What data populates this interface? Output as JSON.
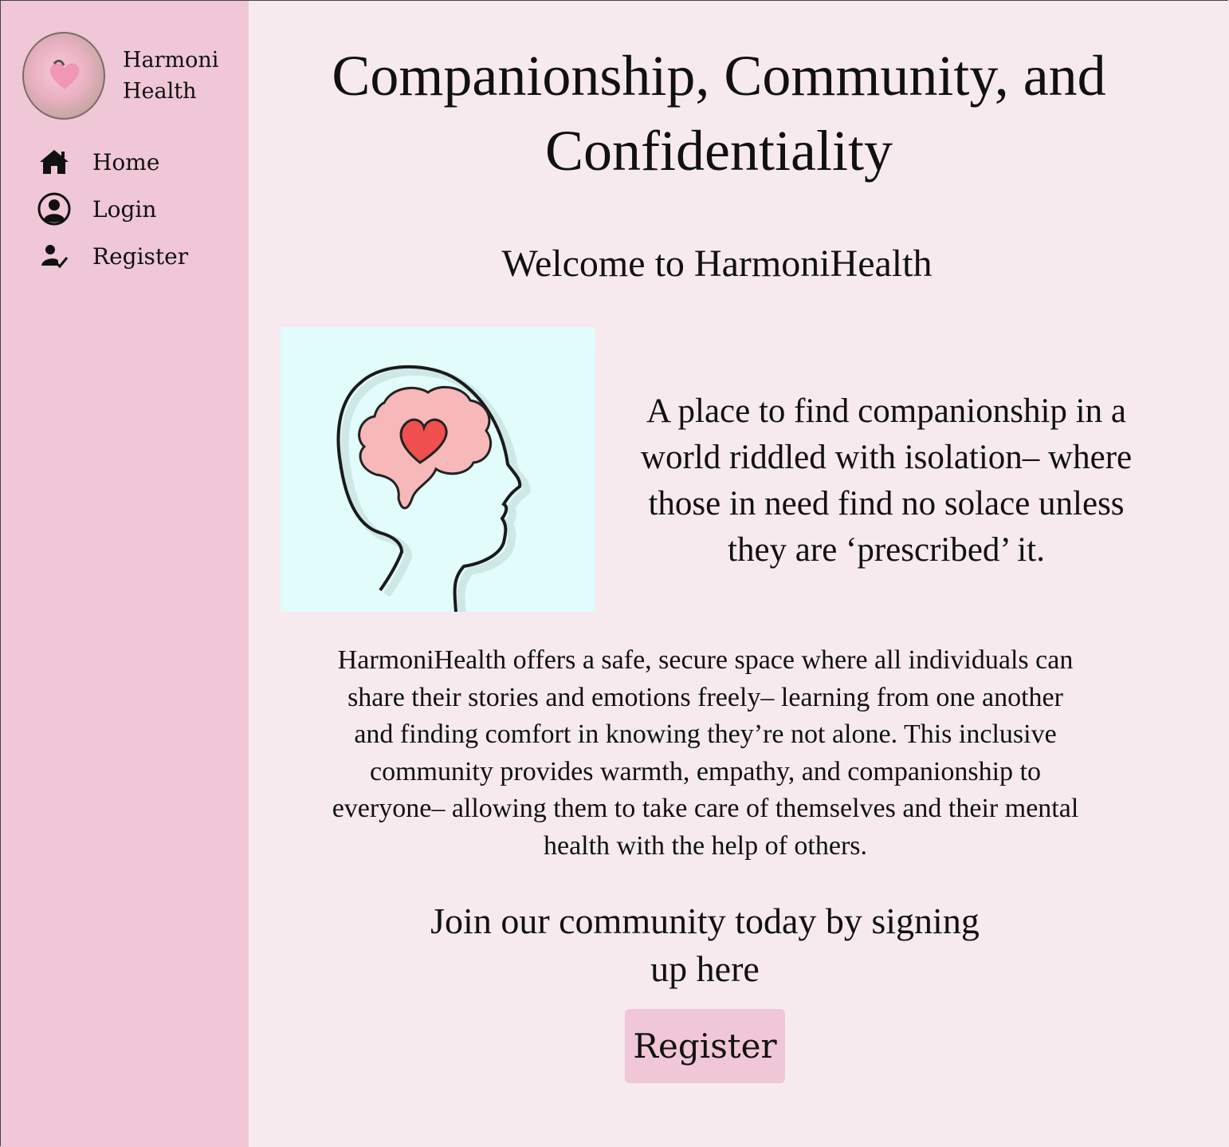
{
  "sidebar": {
    "brand": {
      "line1": "Harmoni",
      "line2": "Health"
    },
    "nav": [
      {
        "label": "Home",
        "icon": "home-icon"
      },
      {
        "label": "Login",
        "icon": "user-circle-icon"
      },
      {
        "label": "Register",
        "icon": "user-check-icon"
      }
    ]
  },
  "main": {
    "title": "Companionship, Community, and Confidentiality",
    "welcome": "Welcome to HarmoniHealth",
    "tagline": "A place to find companionship in a world riddled with isolation– where those in need find no solace unless they are ‘prescribed’ it.",
    "description": "HarmoniHealth offers a safe, secure space where all individuals can share their stories and emotions freely– learning from one another and finding comfort in knowing they’re not alone. This inclusive community provides warmth, empathy, and companionship to everyone– allowing them to take care of themselves and their mental health with the help of others.",
    "join": "Join our community today by signing up here",
    "register_button": "Register"
  },
  "colors": {
    "sidebar_bg": "#efc7d6",
    "page_bg": "#f7eaee",
    "illustration_bg": "#e2fbfb",
    "button_bg": "#efc7d6"
  }
}
